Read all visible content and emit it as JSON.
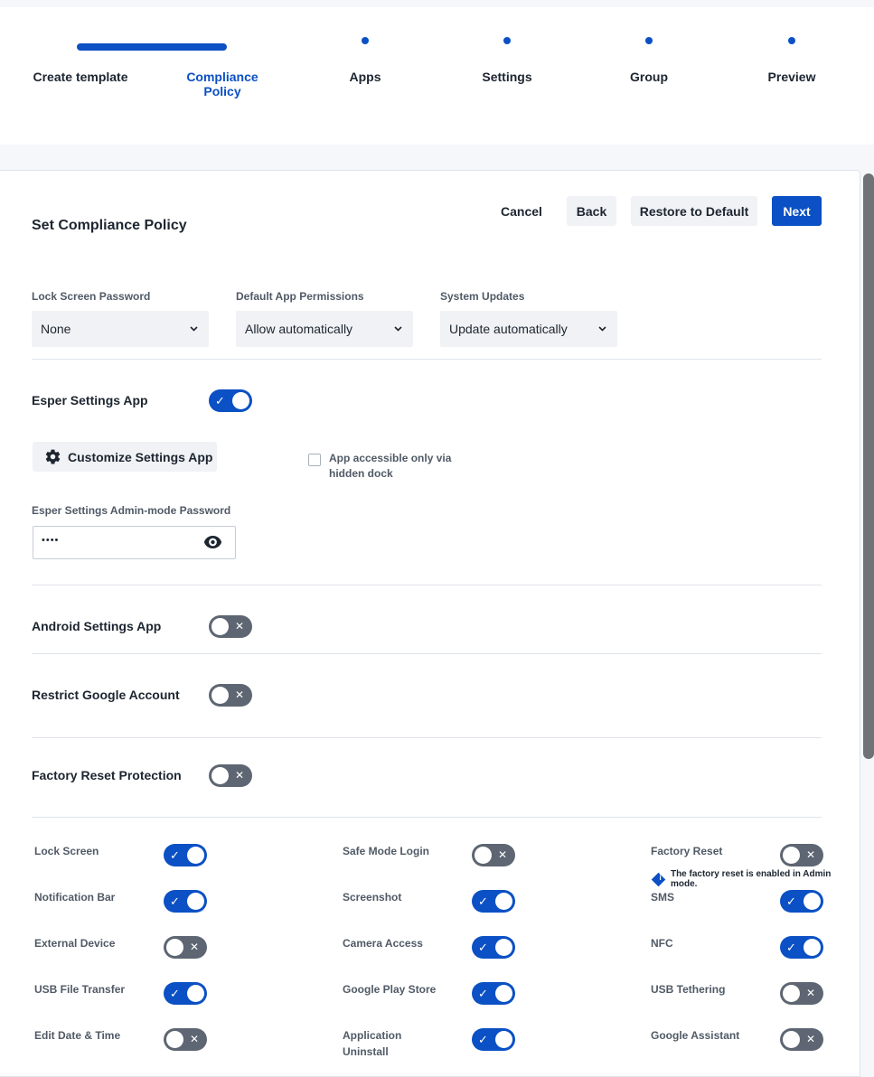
{
  "stepper": {
    "steps": [
      {
        "label": "Create template",
        "state": "done"
      },
      {
        "label": "Compliance Policy",
        "state": "active"
      },
      {
        "label": "Apps",
        "state": "upcoming"
      },
      {
        "label": "Settings",
        "state": "upcoming"
      },
      {
        "label": "Group",
        "state": "upcoming"
      },
      {
        "label": "Preview",
        "state": "upcoming"
      }
    ],
    "accent_color": "#0b50c4"
  },
  "page": {
    "title": "Set Compliance Policy",
    "buttons": {
      "cancel": "Cancel",
      "back": "Back",
      "restore": "Restore to Default",
      "next": "Next"
    }
  },
  "dropdowns": [
    {
      "label": "Lock Screen Password",
      "value": "None"
    },
    {
      "label": "Default App Permissions",
      "value": "Allow automatically"
    },
    {
      "label": "System Updates",
      "value": "Update automatically"
    }
  ],
  "esper_settings": {
    "label": "Esper Settings App",
    "enabled": true,
    "customize_button": "Customize Settings App",
    "hidden_dock_label": "App accessible only via hidden dock",
    "hidden_dock_checked": false,
    "password_label": "Esper Settings Admin-mode Password",
    "password_value": "••••"
  },
  "toggle_rows": [
    {
      "label": "Android Settings App",
      "enabled": false
    },
    {
      "label": "Restrict Google Account",
      "enabled": false
    },
    {
      "label": "Factory Reset Protection",
      "enabled": false
    }
  ],
  "restrictions": {
    "col1": [
      {
        "label": "Lock Screen",
        "enabled": true
      },
      {
        "label": "Notification Bar",
        "enabled": true
      },
      {
        "label": "External Device",
        "enabled": false
      },
      {
        "label": "USB File Transfer",
        "enabled": true
      },
      {
        "label": "Edit Date & Time",
        "enabled": false
      }
    ],
    "col2": [
      {
        "label": "Safe Mode Login",
        "enabled": false
      },
      {
        "label": "Screenshot",
        "enabled": true
      },
      {
        "label": "Camera Access",
        "enabled": true
      },
      {
        "label": "Google Play Store",
        "enabled": true
      },
      {
        "label": "Application Uninstall",
        "enabled": true
      }
    ],
    "col3": [
      {
        "label": "Factory Reset",
        "enabled": false
      },
      {
        "label": "SMS",
        "enabled": true
      },
      {
        "label": "NFC",
        "enabled": true
      },
      {
        "label": "USB Tethering",
        "enabled": false
      },
      {
        "label": "Google Assistant",
        "enabled": false
      }
    ],
    "factory_reset_note": "The factory reset is enabled in Admin mode."
  },
  "icons": {
    "toggle_on": "check-icon",
    "toggle_off": "x-icon",
    "dropdown": "chevron-down-icon",
    "customize": "gear-icon",
    "password_visibility": "eye-icon",
    "note": "info-icon"
  }
}
